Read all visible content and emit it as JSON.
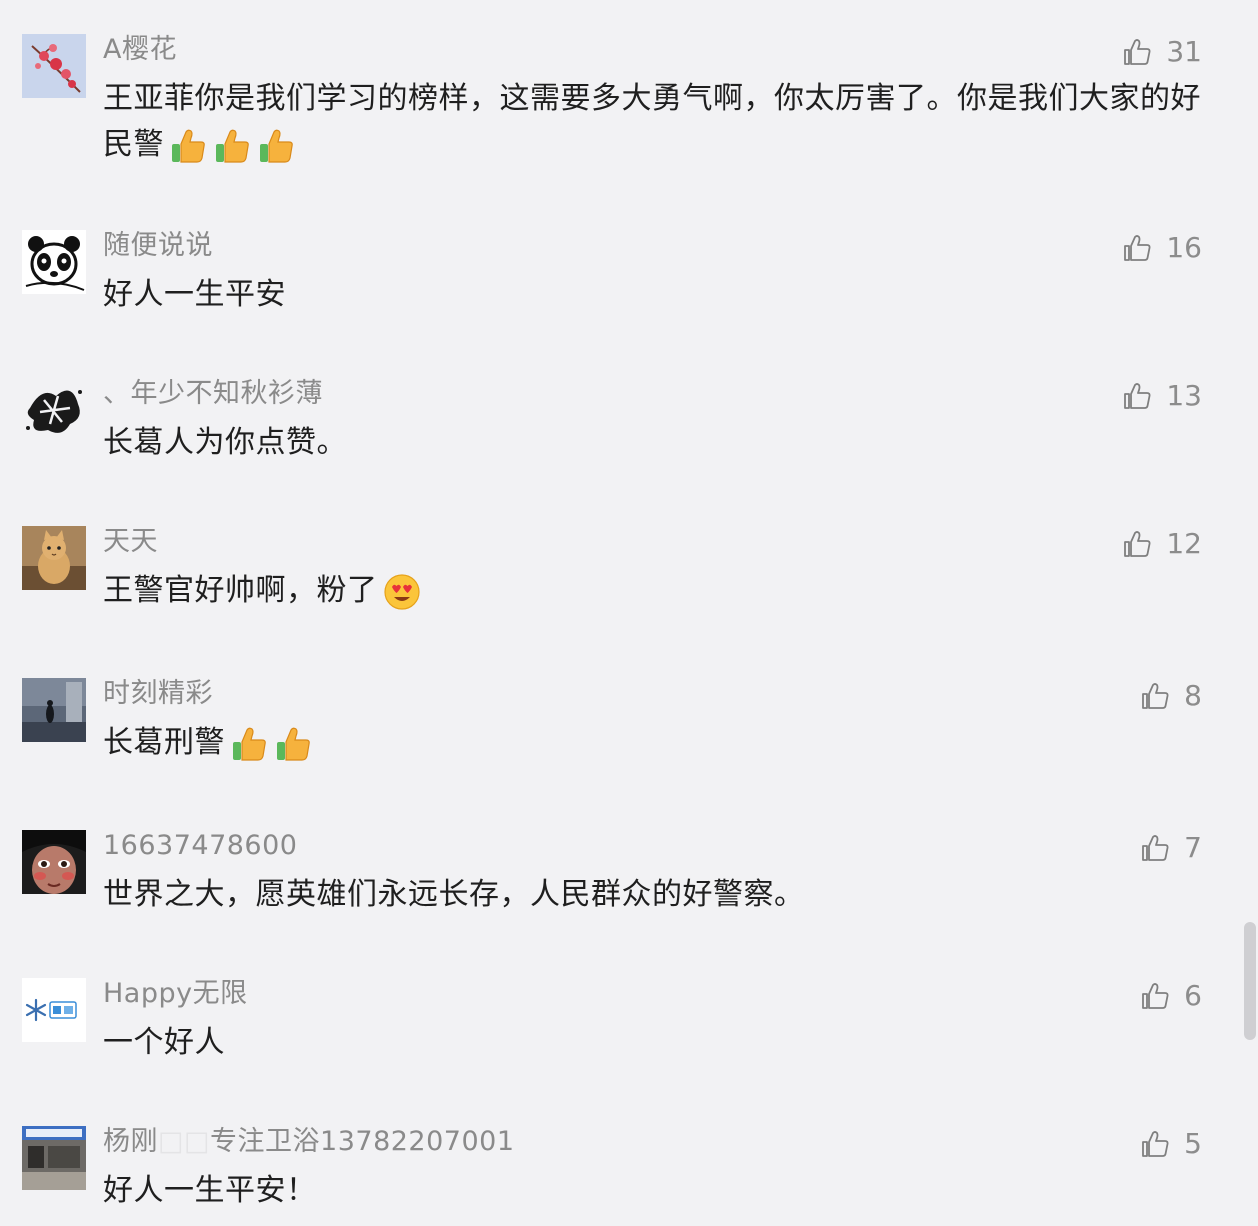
{
  "comments": [
    {
      "username": "A樱花",
      "text": "王亚菲你是我们学习的榜样，这需要多大勇气啊，你太厉害了。你是我们大家的好民警",
      "likes": "31",
      "avatar": "cherry-blossom-avatar",
      "emojis": [
        "thumbs-up-emoji",
        "thumbs-up-emoji",
        "thumbs-up-emoji"
      ]
    },
    {
      "username": "随便说说",
      "text": "好人一生平安",
      "likes": "16",
      "avatar": "panda-avatar"
    },
    {
      "username": "、年少不知秋衫薄",
      "text": "长葛人为你点赞。",
      "likes": "13",
      "avatar": "ink-splash-avatar"
    },
    {
      "username": "天天",
      "text": "王警官好帅啊，粉了",
      "likes": "12",
      "avatar": "cat-avatar",
      "emojis": [
        "heart-eyes-emoji"
      ]
    },
    {
      "username": "时刻精彩",
      "text": "长葛刑警",
      "likes": "8",
      "avatar": "street-night-avatar",
      "emojis": [
        "thumbs-up-emoji",
        "thumbs-up-emoji"
      ]
    },
    {
      "username": "16637478600",
      "text": "世界之大，愿英雄们永远长存，人民群众的好警察。",
      "likes": "7",
      "avatar": "face-avatar"
    },
    {
      "username": "Happy无限",
      "text": "一个好人",
      "likes": "6",
      "avatar": "snowflake-logo-avatar"
    },
    {
      "username": "杨刚",
      "username_placeholder": "□□",
      "username_suffix": "专注卫浴13782207001",
      "text": "好人一生平安！",
      "likes": "5",
      "avatar": "storefront-avatar"
    }
  ],
  "colors": {
    "background": "#f2f2f4",
    "username": "#8a8a8a",
    "text": "#1f1f1f",
    "like": "#8c8c8c"
  }
}
